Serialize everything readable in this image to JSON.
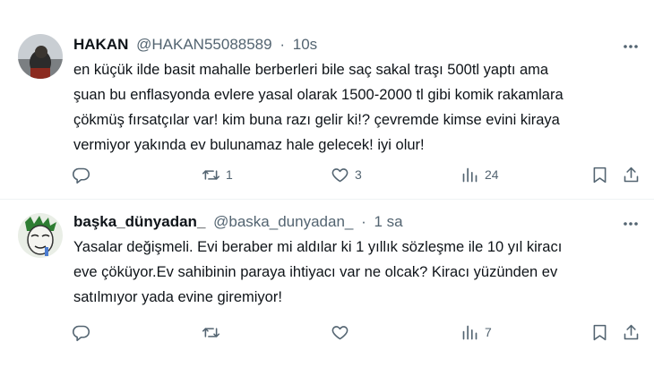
{
  "tweets": [
    {
      "name": "HAKAN",
      "handle": "@HAKAN55088589",
      "separator": "·",
      "time": "10s",
      "text_lines": [
        "en küçük ilde basit mahalle berberleri bile saç sakal traşı 500tl yaptı ama",
        "şuan bu enflasyonda evlere yasal olarak 1500-2000 tl gibi komik rakamlara",
        "çökmüş fırsatçılar var! kim buna razı gelir ki!? çevremde kimse evini kiraya",
        "vermiyor yakında ev bulunamaz hale gelecek! iyi olur!"
      ],
      "actions": {
        "reply": "",
        "retweet": "1",
        "like": "3",
        "views": "24"
      }
    },
    {
      "name": "başka_dünyadan_",
      "handle": "@baska_dunyadan_",
      "separator": "·",
      "time": "1 sa",
      "text_lines": [
        "Yasalar değişmeli. Evi beraber mi aldılar ki 1 yıllık sözleşme ile 10 yıl kiracı",
        "eve çöküyor.Ev sahibinin paraya ihtiyacı var ne olcak? Kiracı yüzünden ev",
        "satılmıyor yada evine giremiyor!"
      ],
      "actions": {
        "reply": "",
        "retweet": "",
        "like": "",
        "views": "7"
      }
    }
  ],
  "icons": {
    "reply": "reply-icon",
    "retweet": "retweet-icon",
    "like": "heart-icon",
    "views": "views-icon",
    "bookmark": "bookmark-icon",
    "share": "share-icon",
    "more": "more-icon"
  },
  "colors": {
    "text": "#0f1419",
    "secondary": "#536471",
    "divider": "#eff3f4"
  }
}
